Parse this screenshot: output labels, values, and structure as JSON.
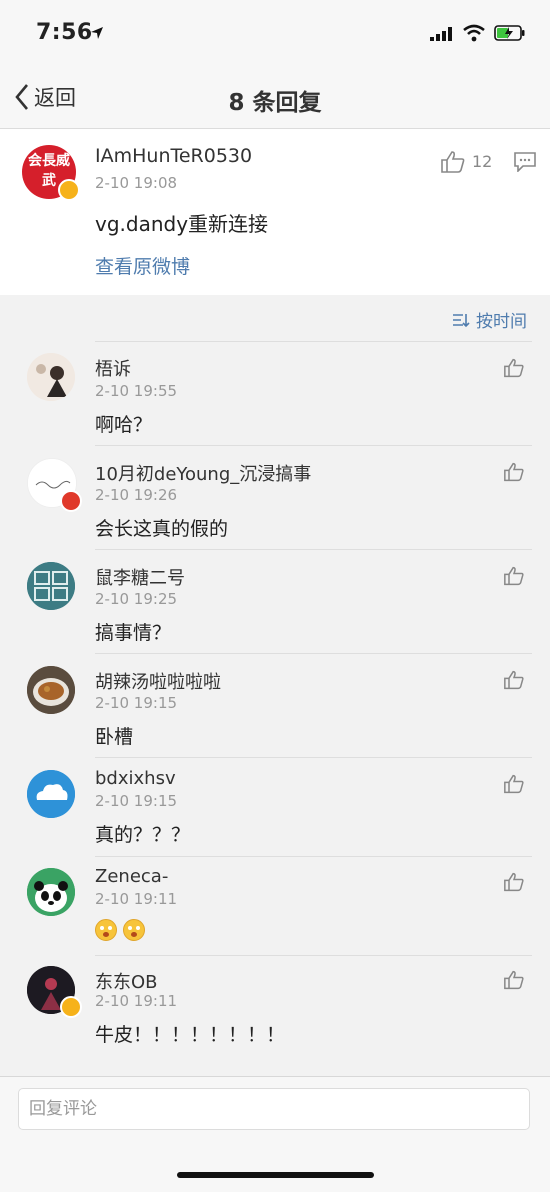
{
  "status_bar": {
    "time": "7:56"
  },
  "nav": {
    "back_label": "返回",
    "title": "8 条回复"
  },
  "main_post": {
    "avatar_text": "会長威武",
    "author": "IAmHunTeR0530",
    "time": "2-10 19:08",
    "likes": "12",
    "text": "vg.dandy重新连接",
    "view_original": "查看原微博"
  },
  "sort": {
    "label": "按时间"
  },
  "replies": [
    {
      "name": "梧诉",
      "time": "2-10 19:55",
      "text": "啊哈？"
    },
    {
      "name": "10月初deYoung_沉浸搞事",
      "time": "2-10 19:26",
      "text": "会长这真的假的"
    },
    {
      "name": "鼠李糖二号",
      "time": "2-10 19:25",
      "text": "搞事情？"
    },
    {
      "name": "胡辣汤啦啦啦啦",
      "time": "2-10 19:15",
      "text": "卧槽"
    },
    {
      "name": "bdxixhsv",
      "time": "2-10 19:15",
      "text": "真的？？？"
    },
    {
      "name": "Zeneca-",
      "time": "2-10 19:11",
      "text": ""
    },
    {
      "name": "东东OB",
      "time": "2-10 19:11",
      "text": "牛皮！！！！！！！！"
    }
  ],
  "reply_box": {
    "placeholder": "回复评论"
  },
  "colors": {
    "link": "#4f7cae",
    "badge_gold": "#f6b21a",
    "avatar_red": "#d51f2b"
  }
}
